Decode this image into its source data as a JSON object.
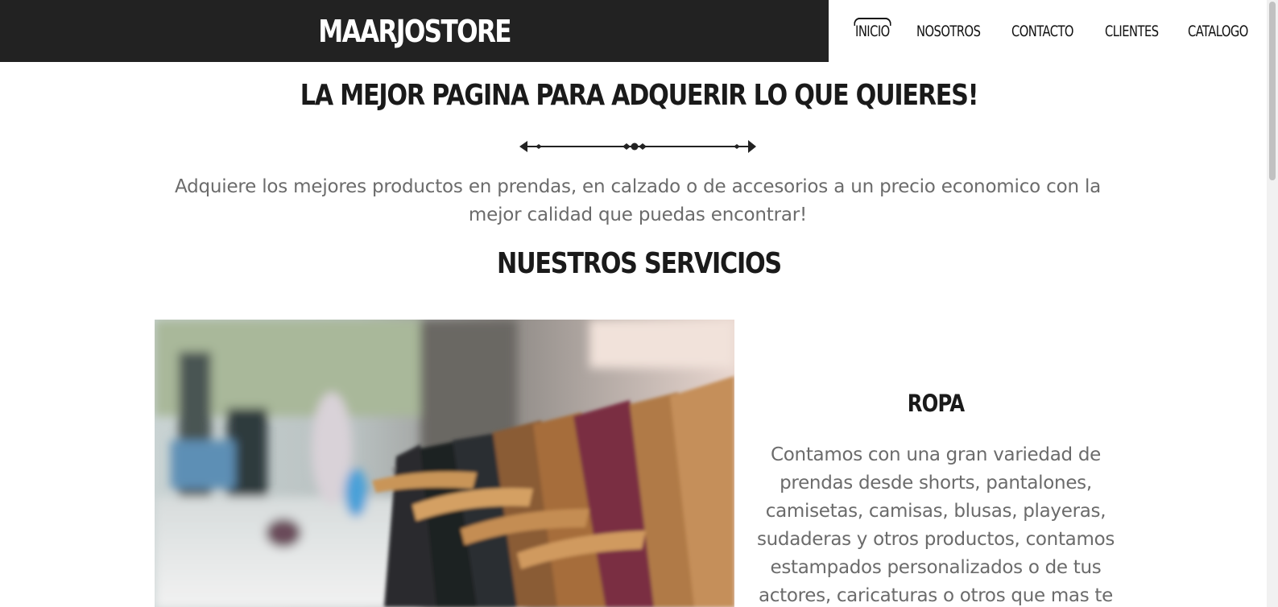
{
  "header": {
    "brand": "MAARJOSTORE",
    "nav": [
      {
        "label": "INICIO",
        "active": true
      },
      {
        "label": "NOSOTROS",
        "active": false
      },
      {
        "label": "CONTACTO",
        "active": false
      },
      {
        "label": "CLIENTES",
        "active": false
      },
      {
        "label": "CATALOGO",
        "active": false
      }
    ]
  },
  "hero": {
    "headline": "LA MEJOR PAGINA PARA ADQUERIR LO QUE QUIERES!",
    "intro": "Adquiere los mejores productos en prendas, en calzado o de accesorios a un precio economico con la mejor calidad que puedas encontrar!"
  },
  "services": {
    "title": "NUESTROS SERVICIOS",
    "items": [
      {
        "title": "ROPA",
        "text": "Contamos con una gran variedad de prendas desde shorts, pantalones, camisetas, camisas, blusas, playeras, sudaderas y otros productos, contamos estampados personalizados o de tus actores, caricaturas o otros que mas te"
      }
    ]
  },
  "colors": {
    "header_bg": "#222222",
    "text_dark": "#1a1a1a",
    "text_muted": "#6b6b6b"
  }
}
